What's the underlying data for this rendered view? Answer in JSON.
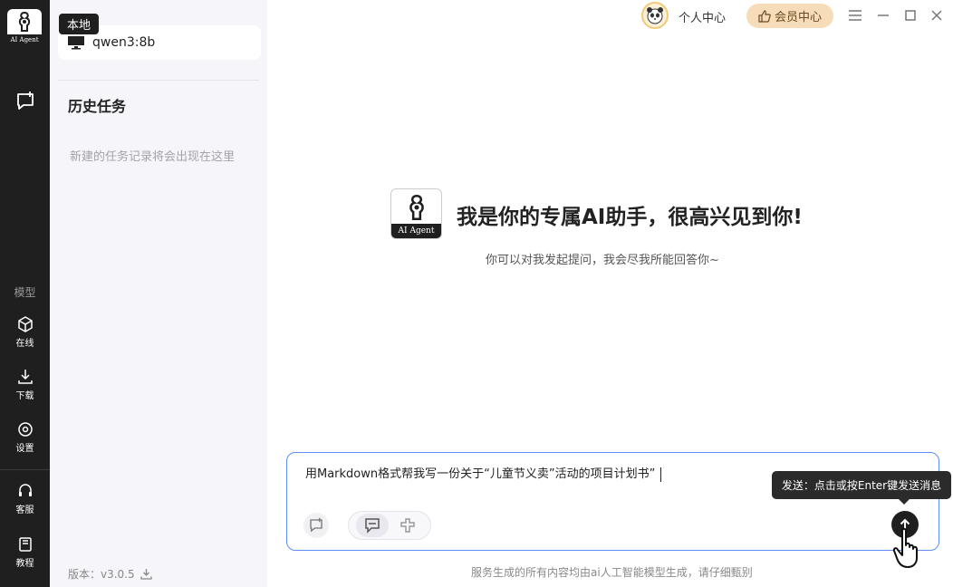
{
  "rail": {
    "logo_caption": "AI Agent",
    "section_model": "模型",
    "items": [
      {
        "label": "在线"
      },
      {
        "label": "下载"
      },
      {
        "label": "设置"
      },
      {
        "label": "客服"
      },
      {
        "label": "教程"
      }
    ]
  },
  "sidebar": {
    "tag": "本地",
    "model_name": "qwen3:8b",
    "history_title": "历史任务",
    "history_empty": "新建的任务记录将会出现在这里",
    "version": "版本：v3.0.5"
  },
  "topbar": {
    "personal_center": "个人中心",
    "vip_center": "会员中心"
  },
  "main": {
    "logo_caption": "AI Agent",
    "title": "我是你的专属AI助手，很高兴见到你!",
    "subtitle": "你可以对我发起提问，我会尽我所能回答你~",
    "input_text": "用Markdown格式帮我写一份关于“儿童节义卖”活动的项目计划书”",
    "send_tooltip": "发送：点击或按Enter键发送消息",
    "footer_note": "服务生成的所有内容均由ai人工智能模型生成，请仔细甄别"
  },
  "colors": {
    "rail_bg": "#1f1f1f",
    "sidebar_bg": "#f6f5f9",
    "input_border": "#5d8df5",
    "vip_bg": "#f6dcb8"
  }
}
